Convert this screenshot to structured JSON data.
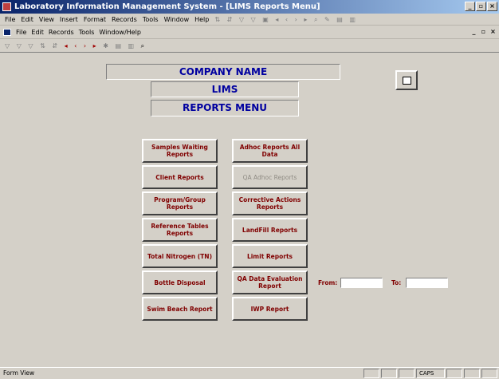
{
  "window": {
    "title": "Laboratory Information Management System - [LIMS Reports Menu]"
  },
  "menu": [
    "File",
    "Edit",
    "View",
    "Insert",
    "Format",
    "Records",
    "Tools",
    "Window",
    "Help"
  ],
  "menu2": [
    "File",
    "Edit",
    "Records",
    "Tools",
    "Window/Help"
  ],
  "header": {
    "company": "COMPANY NAME",
    "lims": "LIMS",
    "reports_menu": "REPORTS MENU"
  },
  "buttons": {
    "samples_waiting": "Samples Waiting Reports",
    "client": "Client Reports",
    "program_group": "Program/Group Reports",
    "reference_tables": "Reference Tables Reports",
    "total_nitrogen": "Total Nitrogen (TN)",
    "bottle_disposal": "Bottle Disposal",
    "swim_beach": "Swim Beach Report",
    "adhoc_all": "Adhoc Reports All Data",
    "qa_adhoc": "QA Adhoc Reports",
    "corrective_actions": "Corrective Actions Reports",
    "landfill": "LandFill Reports",
    "limit": "Limit Reports",
    "qa_data_eval": "QA Data Evaluation Report",
    "iwp": "IWP Report"
  },
  "date_range": {
    "from_label": "From:",
    "to_label": "To:"
  },
  "status": {
    "text": "Form View",
    "caps": "CAPS"
  },
  "colors": {
    "title_bar": "#0a246a",
    "heading_text": "#0000a0",
    "button_text": "#800000",
    "disabled_text": "#908c84",
    "face": "#d4d0c8"
  }
}
